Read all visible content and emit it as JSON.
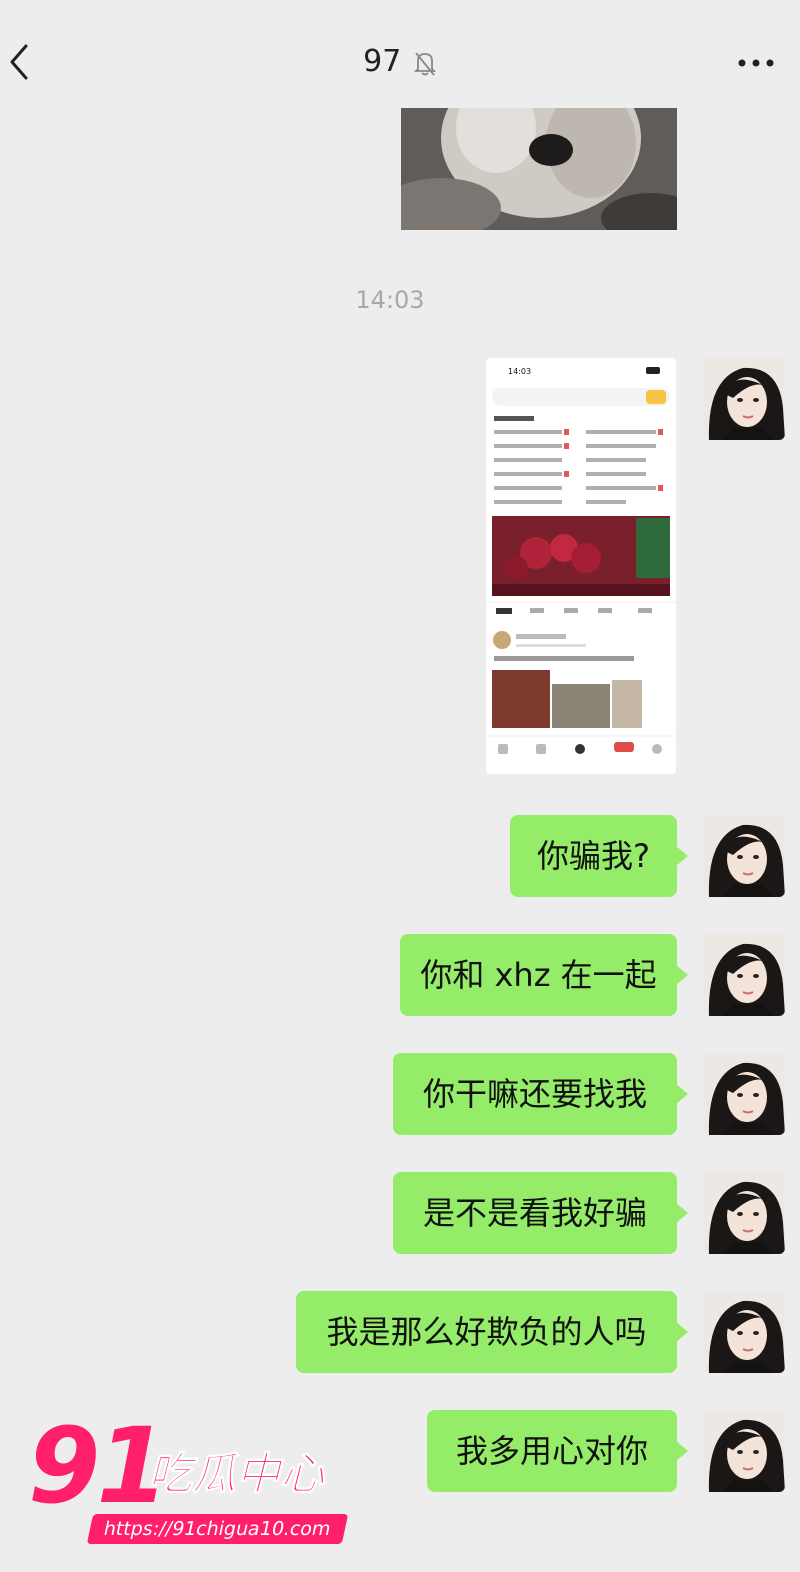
{
  "header": {
    "title": "97",
    "back_icon": "chevron-left-icon",
    "mute_icon": "bell-off-icon",
    "more_icon": "more-dots-icon"
  },
  "messages": {
    "timestamp": "14:03",
    "bubbles": [
      "你骗我?",
      "你和 xhz 在一起",
      "你干嘛还要找我",
      "是不是看我好骗",
      "我是那么好欺负的人吗",
      "我多用心对你"
    ]
  },
  "watermark": {
    "number": "91",
    "name": "吃瓜中心",
    "url": "https://91chigua10.com"
  },
  "colors": {
    "background": "#ededed",
    "bubble": "#95ec69",
    "watermark": "#ff1f6a"
  }
}
